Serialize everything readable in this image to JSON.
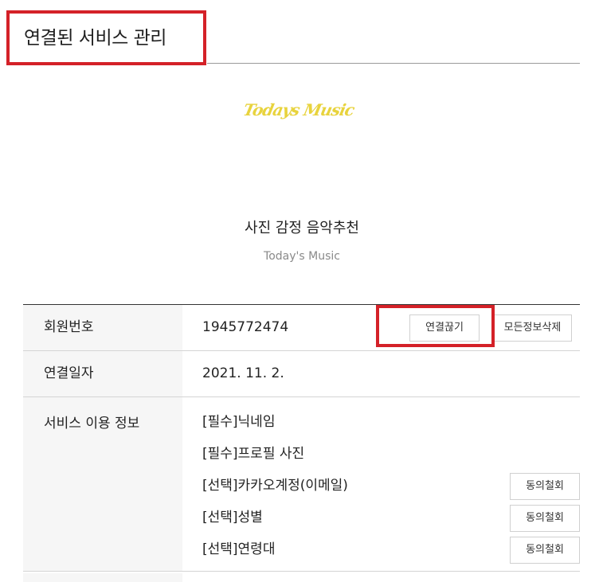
{
  "page": {
    "title": "연결된 서비스 관리"
  },
  "service": {
    "logo_text": "Todays Music",
    "name": "사진 감정 음악추천",
    "subtitle": "Today's Music",
    "logo_color": "#e8d33d"
  },
  "table": {
    "member_label": "회원번호",
    "member_value": "1945772474",
    "disconnect_label": "연결끊기",
    "delete_all_label": "모든정보삭제",
    "date_label": "연결일자",
    "date_value": "2021. 11. 2.",
    "service_info_label": "서비스 이용 정보",
    "permissions": [
      {
        "label": "[필수]닉네임",
        "revoke": ""
      },
      {
        "label": "[필수]프로필 사진",
        "revoke": ""
      },
      {
        "label": "[선택]카카오계정(이메일)",
        "revoke": "동의철회"
      },
      {
        "label": "[선택]성별",
        "revoke": "동의철회"
      },
      {
        "label": "[선택]연령대",
        "revoke": "동의철회"
      }
    ]
  },
  "colors": {
    "highlight": "#d42128",
    "label_bg": "#f6f6f6"
  }
}
